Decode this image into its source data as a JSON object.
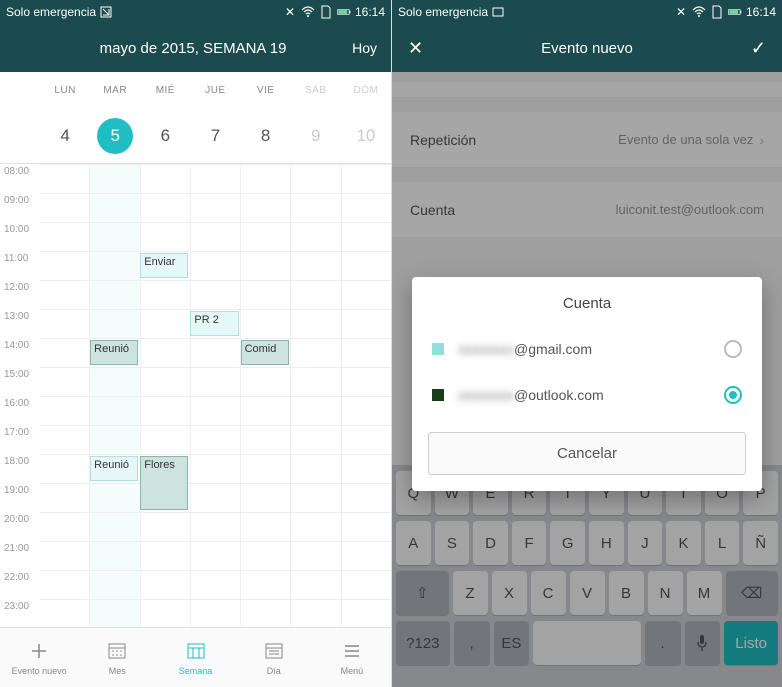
{
  "status": {
    "carrier": "Solo emergencia",
    "time": "16:14"
  },
  "calendar": {
    "title": "mayo de 2015, SEMANA 19",
    "today_label": "Hoy",
    "weekdays": [
      "LUN",
      "MAR",
      "MIÉ",
      "JUE",
      "VIE",
      "SÁB",
      "DOM"
    ],
    "daynums": [
      "4",
      "5",
      "6",
      "7",
      "8",
      "9",
      "10"
    ],
    "selected_index": 1,
    "hours": [
      "08:00",
      "09:00",
      "10:00",
      "11:00",
      "12:00",
      "13:00",
      "14:00",
      "15:00",
      "16:00",
      "17:00",
      "18:00",
      "19:00",
      "20:00",
      "21:00",
      "22:00",
      "23:00"
    ],
    "events": [
      {
        "label": "Enviar",
        "col": 2,
        "row": 3,
        "span": 1,
        "light": true
      },
      {
        "label": "Reunió",
        "col": 1,
        "row": 6,
        "span": 1,
        "light": false
      },
      {
        "label": "PR 2",
        "col": 3,
        "row": 5,
        "span": 1,
        "light": true
      },
      {
        "label": "Comid",
        "col": 4,
        "row": 6,
        "span": 1,
        "light": false
      },
      {
        "label": "Reunió",
        "col": 1,
        "row": 10,
        "span": 1,
        "light": true
      },
      {
        "label": "Flores",
        "col": 2,
        "row": 10,
        "span": 2,
        "light": false
      }
    ]
  },
  "botnav": {
    "items": [
      "Evento nuevo",
      "Mes",
      "Semana",
      "Día",
      "Menú"
    ],
    "active_index": 2
  },
  "phone2": {
    "header": "Evento nuevo",
    "rows": [
      {
        "label": "Repetición",
        "value": "Evento de una sola vez"
      },
      {
        "label": "Cuenta",
        "value": "luiconit.test@outlook.com"
      }
    ]
  },
  "dialog": {
    "title": "Cuenta",
    "accounts": [
      {
        "name_hidden": "xxxxxxxx",
        "domain": "@gmail.com",
        "color": "#8fe0d8",
        "selected": false
      },
      {
        "name_hidden": "xxxxxxxx",
        "domain": "@outlook.com",
        "color": "#1a3d1a",
        "selected": true
      }
    ],
    "cancel": "Cancelar"
  },
  "keyboard": {
    "row1": [
      "Q",
      "W",
      "E",
      "R",
      "T",
      "Y",
      "U",
      "I",
      "O",
      "P"
    ],
    "row2": [
      "A",
      "S",
      "D",
      "F",
      "G",
      "H",
      "J",
      "K",
      "L",
      "Ñ"
    ],
    "row3": [
      "⇧",
      "Z",
      "X",
      "C",
      "V",
      "B",
      "N",
      "M",
      "⌫"
    ],
    "row4_sym": "?123",
    "row4_lang": "ES",
    "row4_done": "Listo"
  }
}
